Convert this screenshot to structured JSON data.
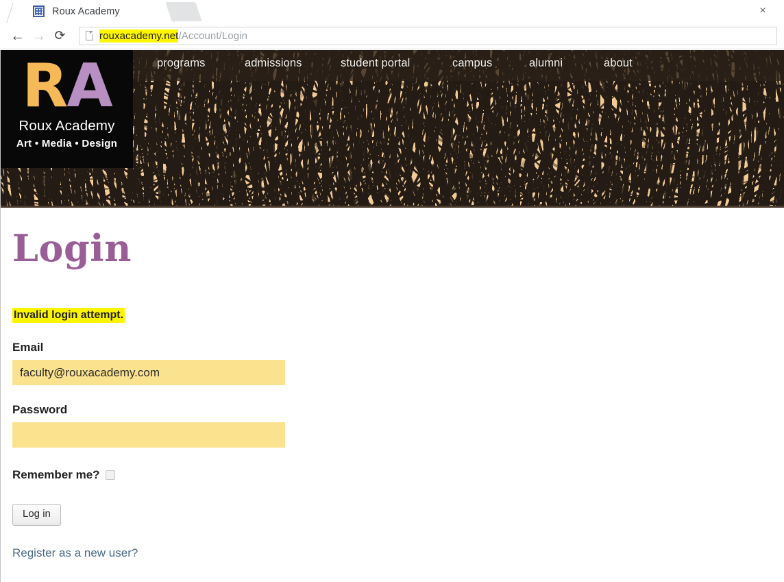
{
  "browser": {
    "tab": {
      "title": "Roux Academy",
      "favicon": "grid-favicon-icon",
      "close_label": "×"
    },
    "new_tab_label": "",
    "back_label": "←",
    "forward_label": "→",
    "reload_label": "⟳",
    "omnibox": {
      "page_icon": "page-document-icon",
      "url_host": "rouxacademy.net",
      "url_path": "/Account/Login",
      "highlight_color": "#fdf500"
    }
  },
  "site": {
    "logo": {
      "mark_r": "R",
      "mark_a": "A",
      "name": "Roux Academy",
      "tagline": "Art • Media • Design",
      "color_r": "#f5b957",
      "color_a": "#b78fc2",
      "background": "#080808"
    },
    "nav": {
      "items": [
        {
          "label": "programs"
        },
        {
          "label": "admissions"
        },
        {
          "label": "student portal"
        },
        {
          "label": "campus"
        },
        {
          "label": "alumni"
        },
        {
          "label": "about"
        }
      ]
    },
    "banner": {
      "background_color": "#f2cb97",
      "ink_color": "#241c14",
      "overlay_color": "rgba(42,32,23,0.78)"
    }
  },
  "page": {
    "title": "Login",
    "title_color": "#9a5e96",
    "error": "Invalid login attempt.",
    "error_highlight": "#fdf500",
    "form": {
      "email": {
        "label": "Email",
        "value": "faculty@rouxacademy.com",
        "placeholder": "",
        "field_color": "#fbe28f"
      },
      "password": {
        "label": "Password",
        "value": "",
        "placeholder": "",
        "field_color": "#fbe28f"
      },
      "remember": {
        "label": "Remember me?",
        "checked": false
      },
      "submit_label": "Log in"
    },
    "register_link": "Register as a new user?",
    "register_link_color": "#4a6b8a"
  }
}
